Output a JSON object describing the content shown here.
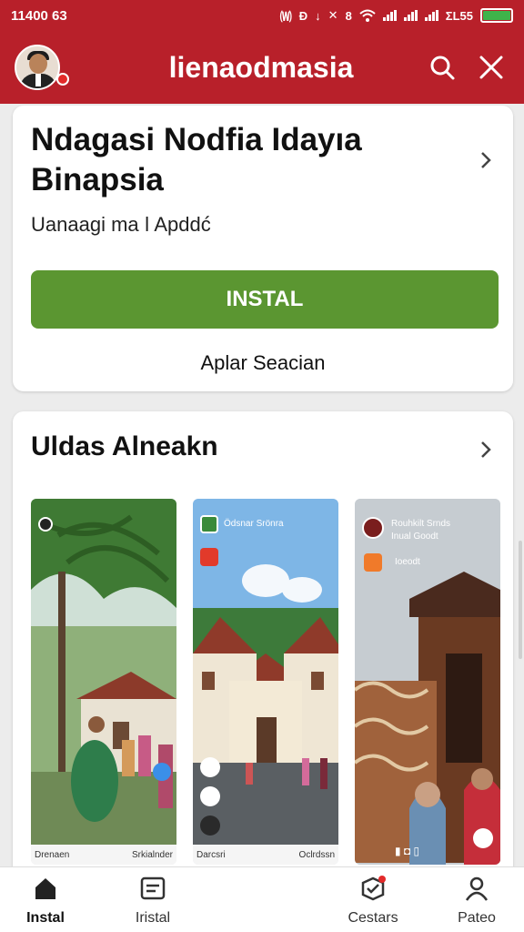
{
  "status_bar": {
    "time": "11400 63",
    "indicators": [
      "🄦",
      "Ɖ",
      "↓",
      "✕",
      "8"
    ],
    "network_text": "ΣL55",
    "battery_color": "#3fb34a"
  },
  "app_bar": {
    "title": "lienaodmasia",
    "background": "#b8202a",
    "avatar_icon": "profile-avatar",
    "search_icon": "search-icon",
    "close_icon": "close-icon"
  },
  "app_card": {
    "title": "Ndagasi Nodfia  Idayıa Binapsia",
    "subtitle": "Uanaagi ma ǀ Apddć",
    "install_button": "INSTAL",
    "install_color": "#5b9631",
    "secondary_link": "Aplar Seacian"
  },
  "screenshots_section": {
    "title": "Uldas Alneakn",
    "screenshots": [
      {
        "caption_left": "Drenaen",
        "caption_right": "Srkialnder"
      },
      {
        "header": "Ödsnar Srönra",
        "caption_left": "Darcsri",
        "caption_right": "Oclrdssn"
      },
      {
        "header_line1": "Rouhkilt Srnds",
        "header_line2": "Inual Goodt",
        "sub": "Ioeodt",
        "pager": "▮ ◘ ▯"
      }
    ]
  },
  "bottom_nav": {
    "items": [
      {
        "label": "Instal",
        "icon": "home-icon",
        "active": true
      },
      {
        "label": "Iristal",
        "icon": "list-icon",
        "active": false
      },
      {
        "label": "Cestars",
        "icon": "box-badge-icon",
        "active": false
      },
      {
        "label": "Pateo",
        "icon": "person-icon",
        "active": false
      }
    ]
  }
}
